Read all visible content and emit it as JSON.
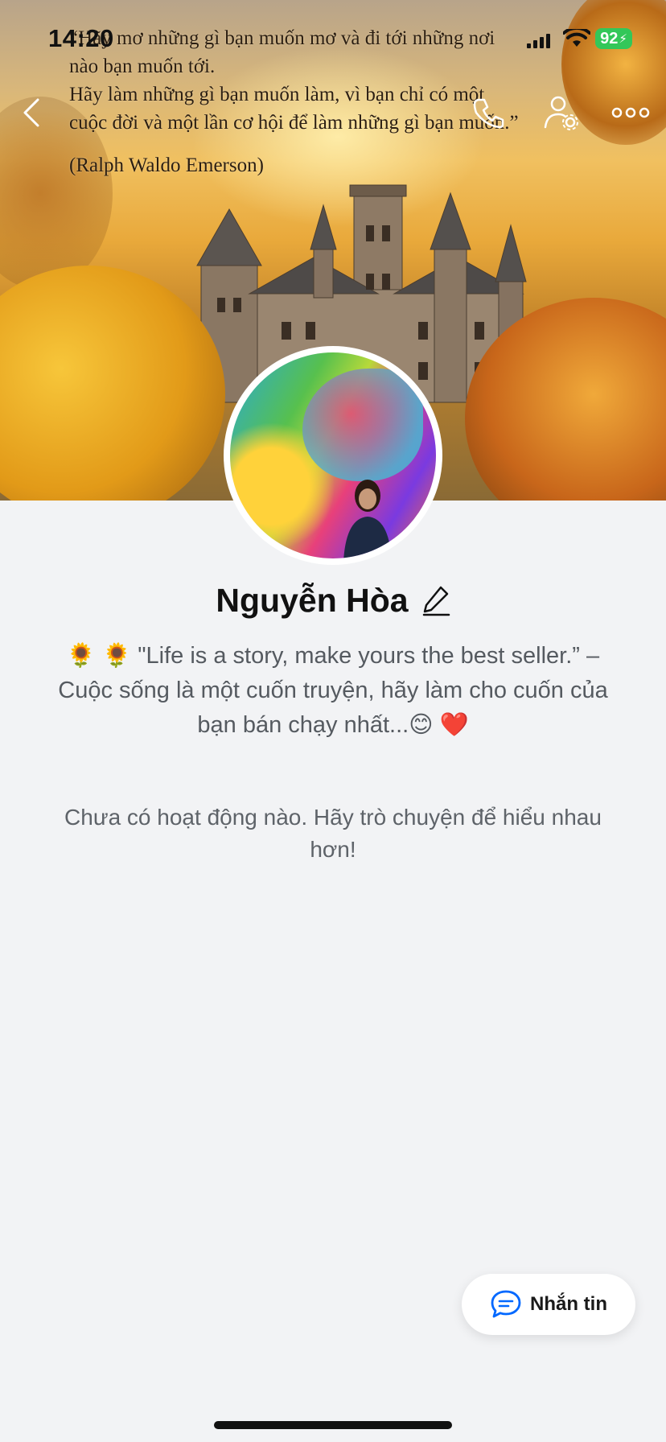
{
  "status_bar": {
    "time": "14:20",
    "battery": "92"
  },
  "cover": {
    "quote_lines": [
      "“Hãy mơ những gì bạn muốn mơ và đi tới những nơi",
      "nào bạn muốn tới.",
      "Hãy làm những gì bạn muốn làm, vì bạn chỉ có một",
      "cuộc đời và một lần cơ hội để làm những gì bạn muốn.”"
    ],
    "author": "(Ralph Waldo Emerson)"
  },
  "nav": {
    "icons": [
      "back-icon",
      "phone-icon",
      "user-settings-icon",
      "more-icon"
    ]
  },
  "profile": {
    "name": "Nguyễn Hòa",
    "bio_line1": "🌻 🌻 \"Life is a story, make yours the best seller.” –",
    "bio_line2": "Cuộc sống là một cuốn truyện, hãy làm cho cuốn của",
    "bio_line3": "bạn bán chạy nhất...😊 ❤️",
    "empty_message": "Chưa có hoạt động nào. Hãy trò chuyện để hiểu nhau hơn!"
  },
  "actions": {
    "message_label": "Nhắn tin"
  },
  "colors": {
    "accent": "#0068ff",
    "battery": "#33c759",
    "background": "#f2f3f5"
  }
}
